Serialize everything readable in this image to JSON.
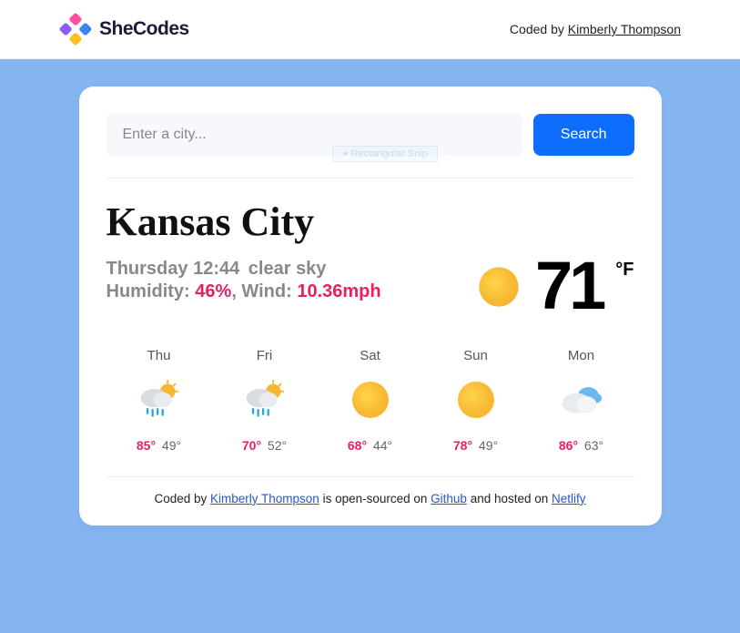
{
  "header": {
    "brand": "SheCodes",
    "credit_prefix": "Coded by ",
    "credit_name": "Kimberly Thompson"
  },
  "search": {
    "placeholder": "Enter a city...",
    "button": "Search",
    "ghost": "Rectangular Snip"
  },
  "current": {
    "city": "Kansas City",
    "day_time": "Thursday 12:44",
    "condition": "clear sky",
    "humidity_label": "Humidity: ",
    "humidity_value": "46%",
    "wind_label": ", Wind: ",
    "wind_value": "10.36mph",
    "temp": "71",
    "unit_deg": "°",
    "unit_f": "F",
    "icon": "sun"
  },
  "forecast": [
    {
      "day": "Thu",
      "icon": "rain-sun",
      "hi": "85°",
      "lo": "49°"
    },
    {
      "day": "Fri",
      "icon": "rain-sun",
      "hi": "70°",
      "lo": "52°"
    },
    {
      "day": "Sat",
      "icon": "sun",
      "hi": "68°",
      "lo": "44°"
    },
    {
      "day": "Sun",
      "icon": "sun",
      "hi": "78°",
      "lo": "49°"
    },
    {
      "day": "Mon",
      "icon": "cloudy",
      "hi": "86°",
      "lo": "63°"
    }
  ],
  "footer": {
    "prefix": "Coded by ",
    "author": "Kimberly Thompson",
    "mid1": " is open-sourced on ",
    "link1": "Github",
    "mid2": " and hosted on ",
    "link2": "Netlify"
  }
}
